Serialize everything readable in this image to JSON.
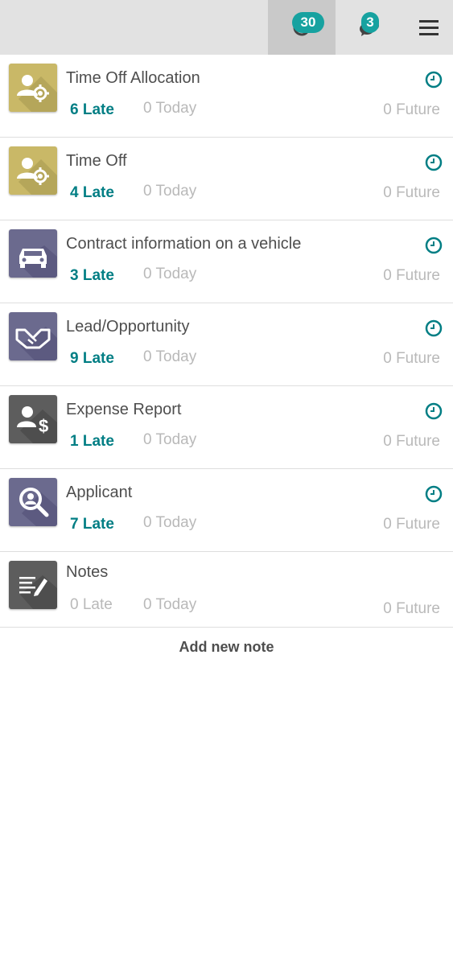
{
  "topbar": {
    "activity_badge": "30",
    "messages_badge": "3",
    "accent_color": "#17a2a0"
  },
  "activities": [
    {
      "icon": "user-gear-icon",
      "title": "Time Off Allocation",
      "late": "6 Late",
      "today": "0 Today",
      "future": "0 Future",
      "color": "#c9b867"
    },
    {
      "icon": "user-gear-icon",
      "title": "Time Off",
      "late": "4 Late",
      "today": "0 Today",
      "future": "0 Future",
      "color": "#c9b867"
    },
    {
      "icon": "car-icon",
      "title": "Contract information on a vehicle",
      "late": "3 Late",
      "today": "0 Today",
      "future": "0 Future",
      "color": "#6b6a8e"
    },
    {
      "icon": "handshake-icon",
      "title": "Lead/Opportunity",
      "late": "9 Late",
      "today": "0 Today",
      "future": "0 Future",
      "color": "#6b6a8e"
    },
    {
      "icon": "user-dollar-icon",
      "title": "Expense Report",
      "late": "1 Late",
      "today": "0 Today",
      "future": "0 Future",
      "color": "#5d5d5d"
    },
    {
      "icon": "magnifier-icon",
      "title": "Applicant",
      "late": "7 Late",
      "today": "0 Today",
      "future": "0 Future",
      "color": "#6b6a8e"
    },
    {
      "icon": "note-pen-icon",
      "title": "Notes",
      "late": "0 Late",
      "today": "0 Today",
      "future": "0 Future",
      "color": "#5d5d5d"
    }
  ],
  "add_note_label": "Add new note"
}
